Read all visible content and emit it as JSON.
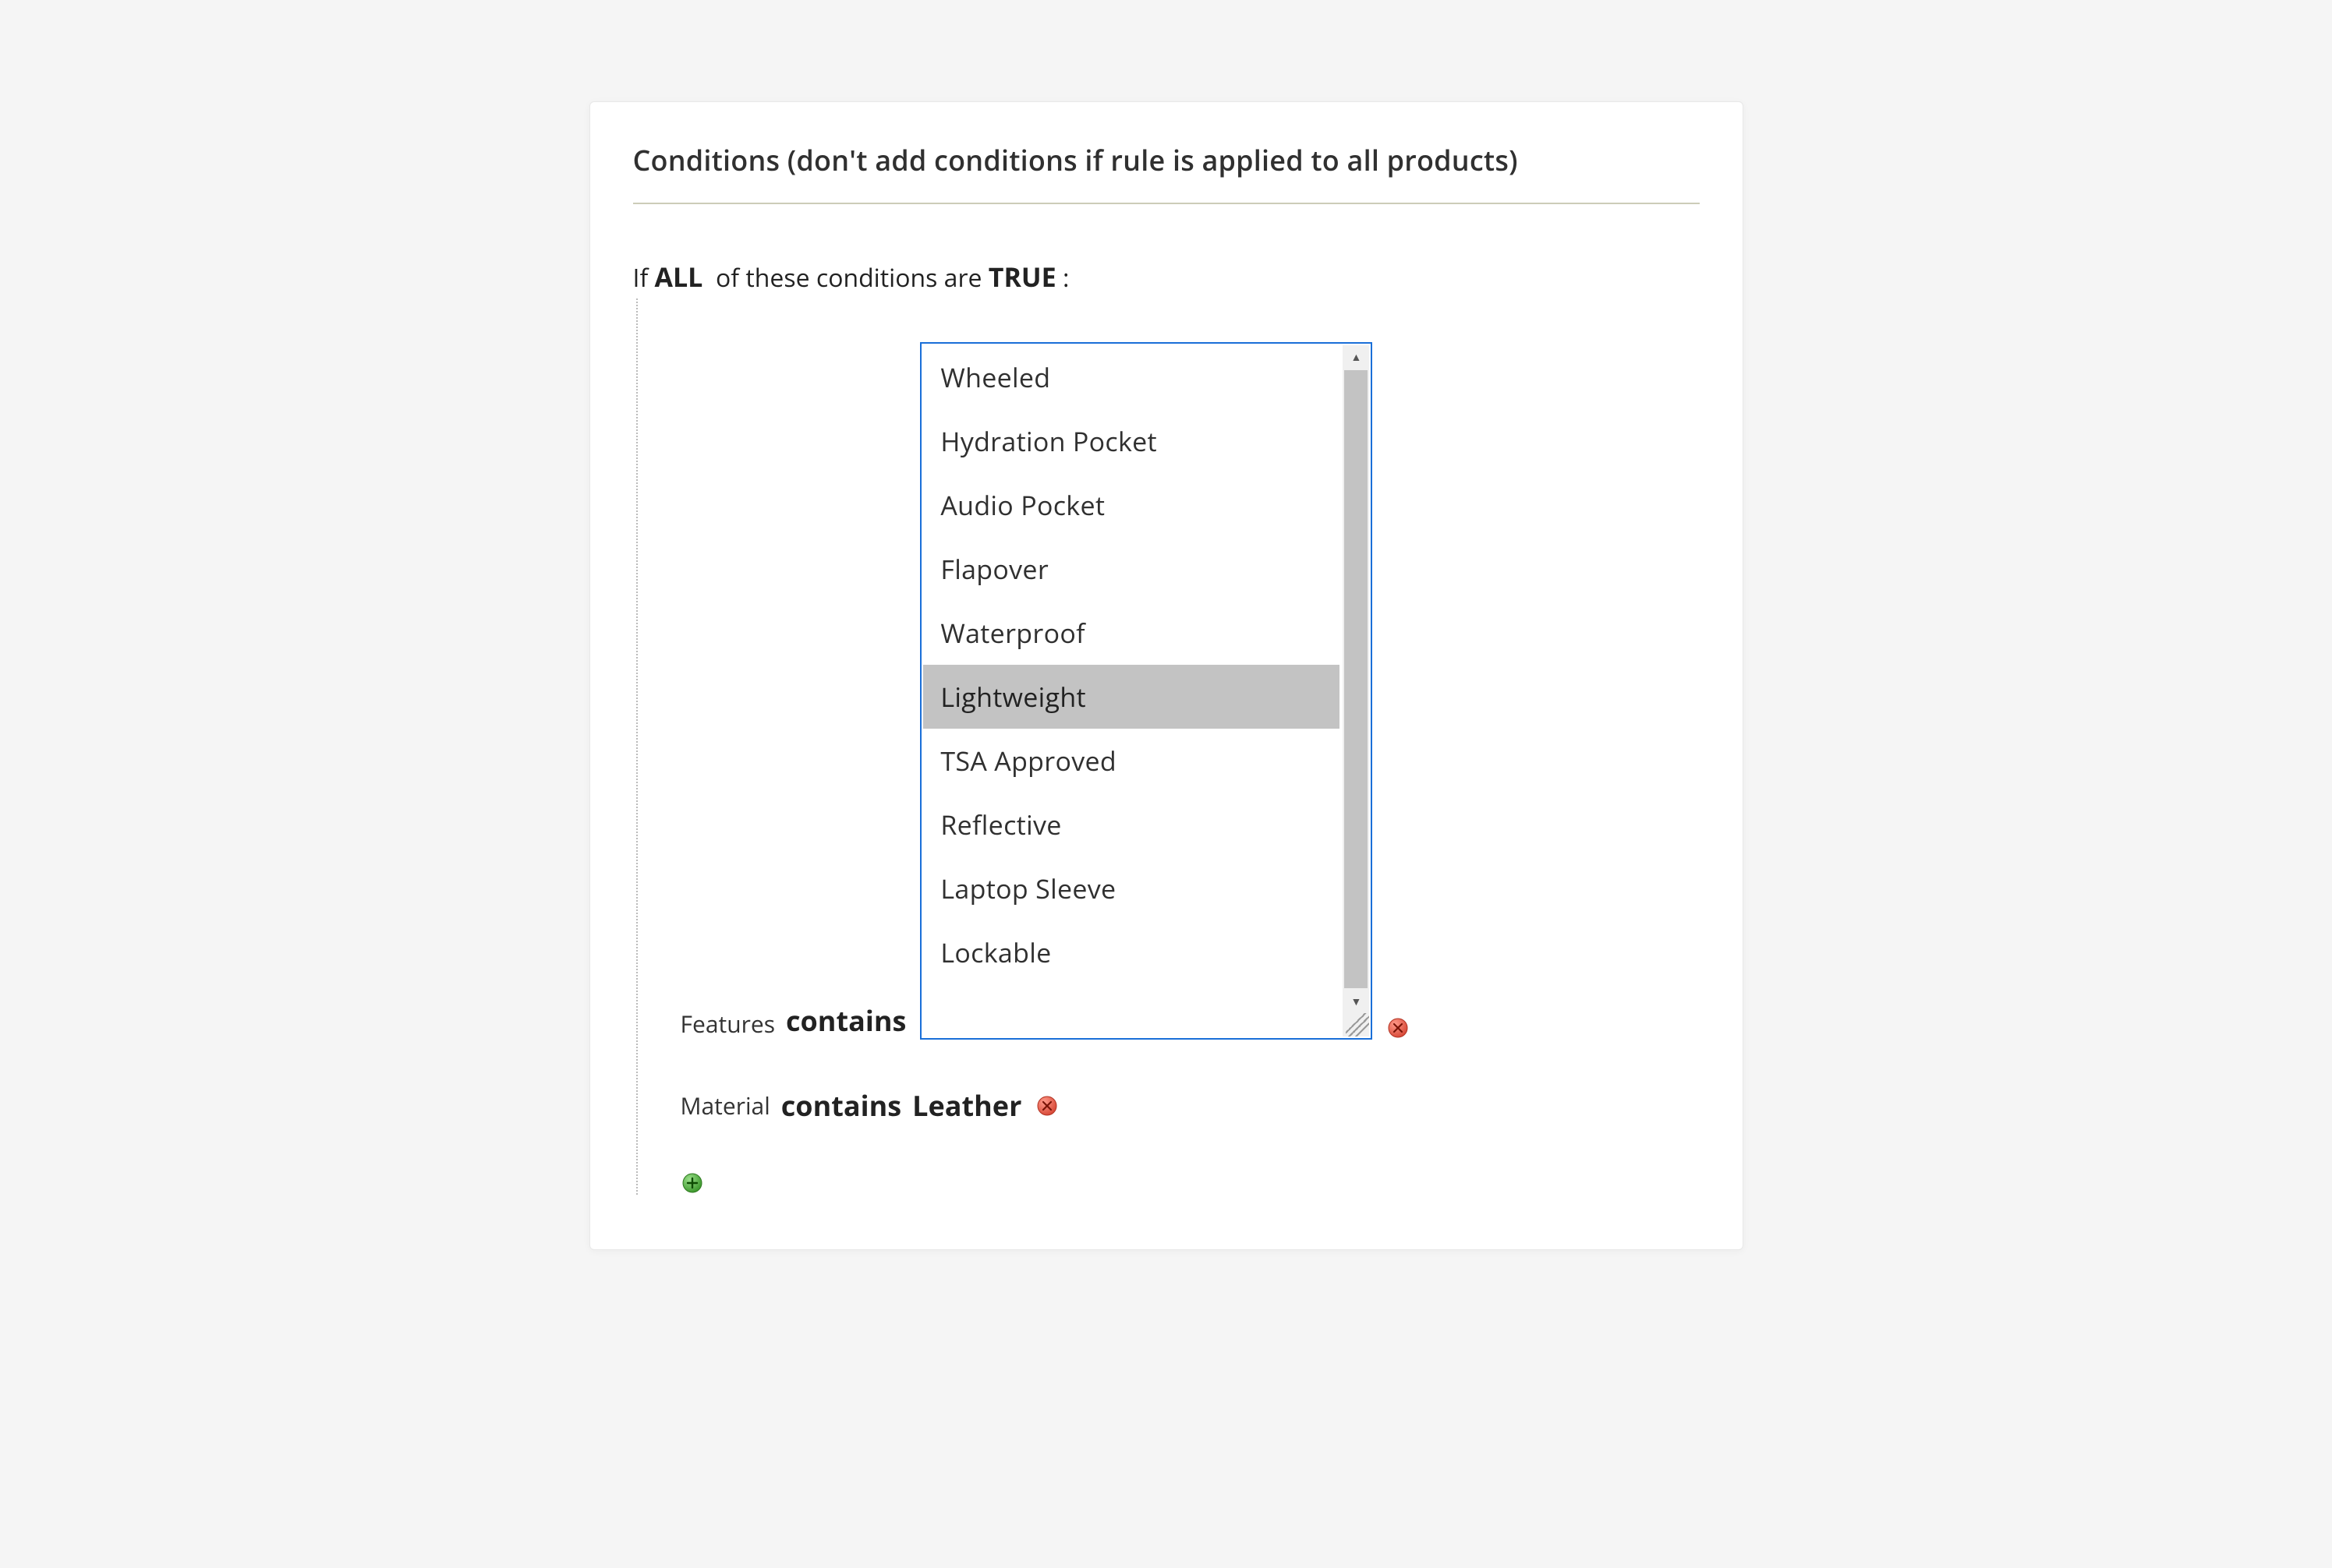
{
  "panel": {
    "title": "Conditions (don't add conditions if rule is applied to all products)"
  },
  "condition_combine": {
    "prefix": "If",
    "aggregator": "ALL",
    "middle": "of these conditions are",
    "value": "TRUE",
    "suffix": ":"
  },
  "rows": {
    "features": {
      "attribute": "Features",
      "operator": "contains",
      "options": [
        "Wheeled",
        "Hydration Pocket",
        "Audio Pocket",
        "Flapover",
        "Waterproof",
        "Lightweight",
        "TSA Approved",
        "Reflective",
        "Laptop Sleeve",
        "Lockable"
      ],
      "selected": "Lightweight"
    },
    "material": {
      "attribute": "Material",
      "operator": "contains",
      "value": "Leather"
    }
  },
  "icons": {
    "remove": "remove-icon",
    "add": "add-icon"
  }
}
